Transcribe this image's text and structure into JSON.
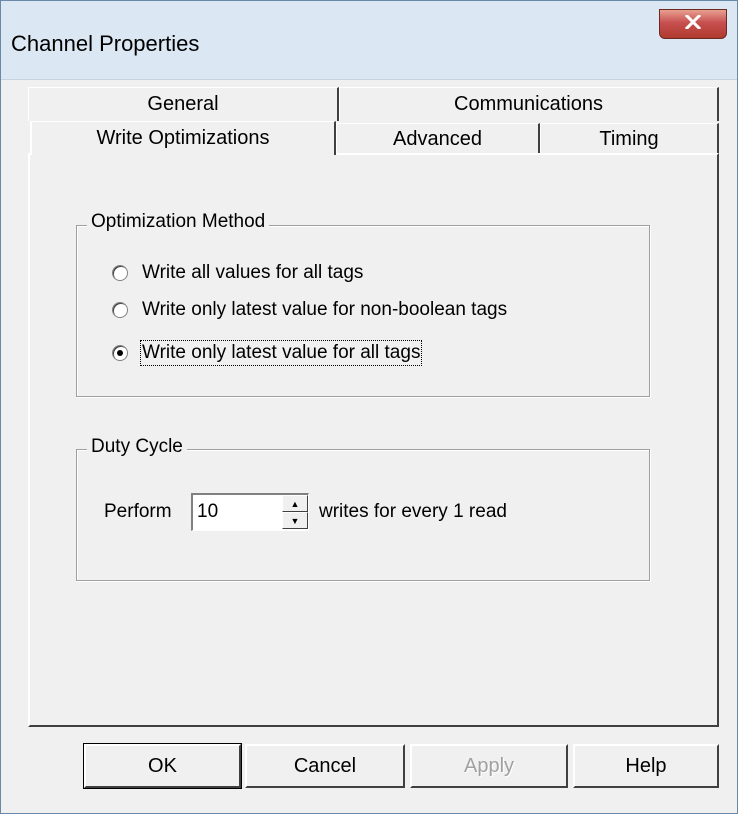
{
  "window": {
    "title": "Channel Properties",
    "close_icon": "close-icon"
  },
  "tabs": {
    "row1": [
      {
        "label": "General"
      },
      {
        "label": "Communications"
      }
    ],
    "row2": [
      {
        "label": "Write Optimizations",
        "active": true
      },
      {
        "label": "Advanced"
      },
      {
        "label": "Timing"
      }
    ]
  },
  "optimization": {
    "legend": "Optimization Method",
    "options": [
      {
        "label": "Write all values for all tags",
        "checked": false
      },
      {
        "label": "Write only latest value for non-boolean tags",
        "checked": false
      },
      {
        "label": "Write only latest value for all tags",
        "checked": true
      }
    ]
  },
  "duty_cycle": {
    "legend": "Duty Cycle",
    "perform_label": "Perform",
    "value": "10",
    "suffix": "writes for every 1 read"
  },
  "buttons": {
    "ok": "OK",
    "cancel": "Cancel",
    "apply": "Apply",
    "help": "Help"
  },
  "colors": {
    "close_button": "#c75050",
    "title_bar": "#dbe7f2",
    "dialog_bg": "#f0f0f0"
  }
}
